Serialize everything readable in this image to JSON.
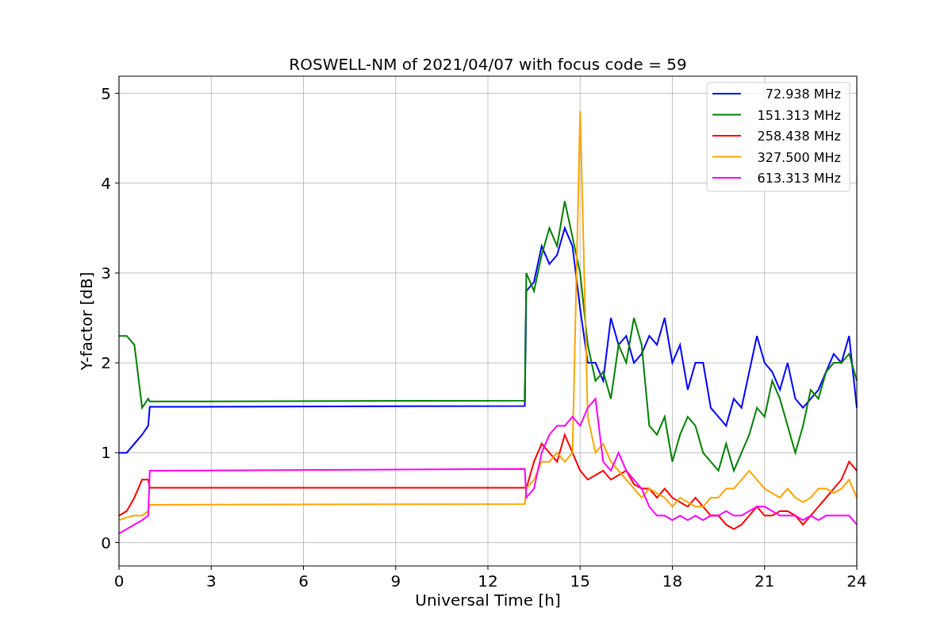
{
  "chart_data": {
    "type": "line",
    "title": "ROSWELL-NM of 2021/04/07 with focus code = 59",
    "xlabel": "Universal Time [h]",
    "ylabel": "Y-factor [dB]",
    "x": [
      0,
      0.25,
      0.5,
      0.75,
      0.95,
      1,
      13.2,
      13.25,
      13.5,
      13.75,
      14,
      14.25,
      14.5,
      14.75,
      15,
      15.25,
      15.5,
      15.75,
      16,
      16.25,
      16.5,
      16.75,
      17,
      17.25,
      17.5,
      17.75,
      18,
      18.25,
      18.5,
      18.75,
      19,
      19.25,
      19.5,
      19.75,
      20,
      20.25,
      20.5,
      20.75,
      21,
      21.25,
      21.5,
      21.75,
      22,
      22.25,
      22.5,
      22.75,
      23,
      23.25,
      23.5,
      23.75,
      24
    ],
    "series": [
      {
        "name": " 72.938 MHz",
        "color": "#0000ff",
        "values": [
          1.0,
          1.0,
          1.1,
          1.2,
          1.3,
          1.51,
          1.52,
          2.8,
          2.9,
          3.3,
          3.1,
          3.2,
          3.5,
          3.3,
          2.6,
          2.0,
          2.0,
          1.8,
          2.5,
          2.2,
          2.3,
          2.0,
          2.1,
          2.3,
          2.2,
          2.5,
          2.0,
          2.2,
          1.7,
          2.0,
          2.0,
          1.5,
          1.4,
          1.3,
          1.6,
          1.5,
          1.9,
          2.3,
          2.0,
          1.9,
          1.7,
          2.0,
          1.6,
          1.5,
          1.6,
          1.7,
          1.9,
          2.1,
          2.0,
          2.3,
          1.5
        ]
      },
      {
        "name": "151.313 MHz",
        "color": "#008000",
        "values": [
          2.3,
          2.3,
          2.2,
          1.5,
          1.6,
          1.57,
          1.58,
          3.0,
          2.8,
          3.2,
          3.5,
          3.3,
          3.8,
          3.4,
          3.0,
          2.2,
          1.8,
          1.9,
          1.6,
          2.2,
          2.0,
          2.5,
          2.2,
          1.3,
          1.2,
          1.4,
          0.9,
          1.2,
          1.4,
          1.3,
          1.0,
          0.9,
          0.8,
          1.1,
          0.8,
          1.0,
          1.2,
          1.5,
          1.4,
          1.8,
          1.6,
          1.3,
          1.0,
          1.3,
          1.7,
          1.6,
          1.9,
          2.0,
          2.0,
          2.1,
          1.8
        ]
      },
      {
        "name": "258.438 MHz",
        "color": "#ff0000",
        "values": [
          0.3,
          0.35,
          0.5,
          0.7,
          0.7,
          0.61,
          0.61,
          0.6,
          0.9,
          1.1,
          1.0,
          0.9,
          1.2,
          1.0,
          0.8,
          0.7,
          0.75,
          0.8,
          0.7,
          0.75,
          0.8,
          0.65,
          0.6,
          0.6,
          0.5,
          0.6,
          0.5,
          0.45,
          0.4,
          0.5,
          0.4,
          0.3,
          0.3,
          0.2,
          0.15,
          0.2,
          0.3,
          0.4,
          0.3,
          0.3,
          0.35,
          0.35,
          0.3,
          0.2,
          0.3,
          0.4,
          0.5,
          0.6,
          0.7,
          0.9,
          0.8
        ]
      },
      {
        "name": "327.500 MHz",
        "color": "#ffa500",
        "values": [
          0.25,
          0.28,
          0.3,
          0.3,
          0.35,
          0.42,
          0.43,
          0.6,
          0.7,
          0.9,
          0.9,
          1.0,
          0.9,
          1.0,
          4.8,
          1.4,
          1.0,
          1.1,
          0.9,
          0.8,
          0.7,
          0.6,
          0.5,
          0.6,
          0.55,
          0.5,
          0.4,
          0.5,
          0.45,
          0.4,
          0.4,
          0.5,
          0.5,
          0.6,
          0.6,
          0.7,
          0.8,
          0.7,
          0.6,
          0.55,
          0.5,
          0.6,
          0.5,
          0.45,
          0.5,
          0.6,
          0.6,
          0.55,
          0.6,
          0.7,
          0.5
        ]
      },
      {
        "name": "613.313 MHz",
        "color": "#ff00ff",
        "values": [
          0.1,
          0.15,
          0.2,
          0.25,
          0.3,
          0.8,
          0.82,
          0.5,
          0.6,
          1.0,
          1.2,
          1.3,
          1.3,
          1.4,
          1.3,
          1.5,
          1.6,
          0.9,
          0.8,
          1.0,
          0.8,
          0.7,
          0.6,
          0.4,
          0.3,
          0.3,
          0.25,
          0.3,
          0.25,
          0.3,
          0.25,
          0.3,
          0.3,
          0.35,
          0.3,
          0.3,
          0.35,
          0.4,
          0.4,
          0.35,
          0.3,
          0.3,
          0.3,
          0.25,
          0.3,
          0.25,
          0.3,
          0.3,
          0.3,
          0.3,
          0.2
        ]
      }
    ],
    "xlim": [
      0,
      24
    ],
    "ylim": [
      -0.26,
      5.19
    ],
    "xticks": [
      0,
      3,
      6,
      9,
      12,
      15,
      18,
      21,
      24
    ],
    "yticks": [
      0,
      1,
      2,
      3,
      4,
      5
    ],
    "grid": true,
    "legend": true
  }
}
